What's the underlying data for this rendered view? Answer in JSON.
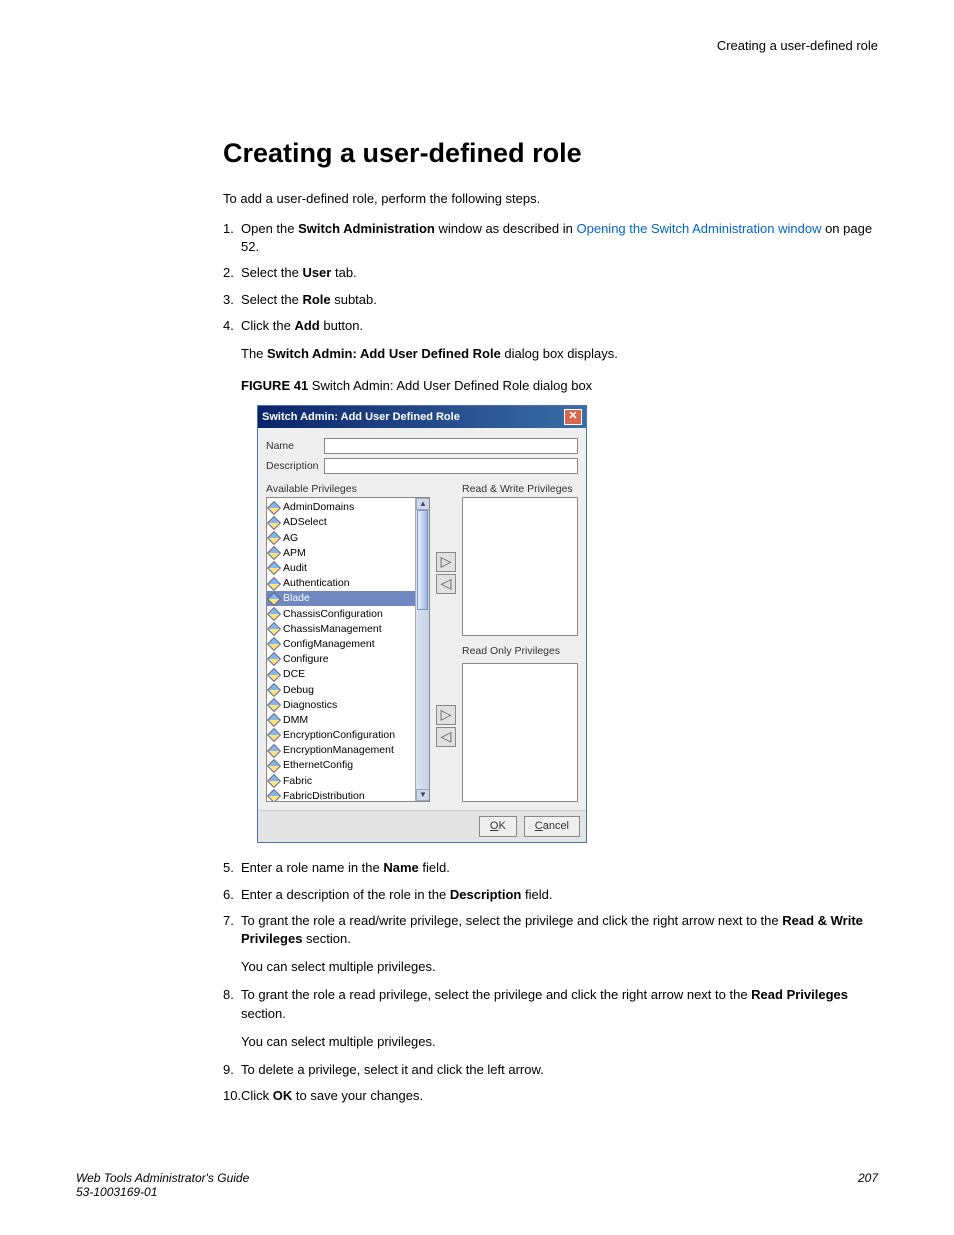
{
  "header": {
    "right": "Creating a user-defined role"
  },
  "title": "Creating a user-defined role",
  "intro": "To add a user-defined role, perform the following steps.",
  "steps": {
    "s1a": "Open the ",
    "s1b": "Switch Administration",
    "s1c": " window as described in ",
    "s1d": "Opening the Switch Administration window",
    "s1e": " on page 52.",
    "s2a": "Select the ",
    "s2b": "User",
    "s2c": " tab.",
    "s3a": "Select the ",
    "s3b": "Role",
    "s3c": " subtab.",
    "s4a": "Click the ",
    "s4b": "Add",
    "s4c": " button.",
    "s4sub_a": "The ",
    "s4sub_b": "Switch Admin: Add User Defined Role",
    "s4sub_c": " dialog box displays.",
    "fig_a": "FIGURE 41 ",
    "fig_b": "Switch Admin: Add User Defined Role dialog box",
    "s5a": "Enter a role name in the ",
    "s5b": "Name",
    "s5c": " field.",
    "s6a": "Enter a description of the role in the ",
    "s6b": "Description",
    "s6c": " field.",
    "s7a": "To grant the role a read/write privilege, select the privilege and click the right arrow next to the ",
    "s7b": "Read & Write Privileges",
    "s7c": " section.",
    "s7sub": "You can select multiple privileges.",
    "s8a": "To grant the role a read privilege, select the privilege and click the right arrow next to the ",
    "s8b": "Read Privileges",
    "s8c": " section.",
    "s8sub": "You can select multiple privileges.",
    "s9": "To delete a privilege, select it and click the left arrow.",
    "s10a": "Click ",
    "s10b": "OK",
    "s10c": " to save your changes."
  },
  "dialog": {
    "title": "Switch Admin: Add User Defined Role",
    "name_label": "Name",
    "desc_label": "Description",
    "avail_label": "Available Privileges",
    "rw_label": "Read & Write Privileges",
    "ro_label": "Read Only Privileges",
    "ok_o": "O",
    "ok_k": "K",
    "cancel_c": "C",
    "cancel_rest": "ancel",
    "privs": [
      "AdminDomains",
      "ADSelect",
      "AG",
      "APM",
      "Audit",
      "Authentication",
      "Blade",
      "ChassisConfiguration",
      "ChassisManagement",
      "ConfigManagement",
      "Configure",
      "DCE",
      "Debug",
      "Diagnostics",
      "DMM",
      "EncryptionConfiguration",
      "EncryptionManagement",
      "EthernetConfig",
      "Fabric",
      "FabricDistribution"
    ],
    "selectedIndex": 6
  },
  "footer": {
    "left1": "Web Tools Administrator's Guide",
    "left2": "53-1003169-01",
    "right": "207"
  }
}
